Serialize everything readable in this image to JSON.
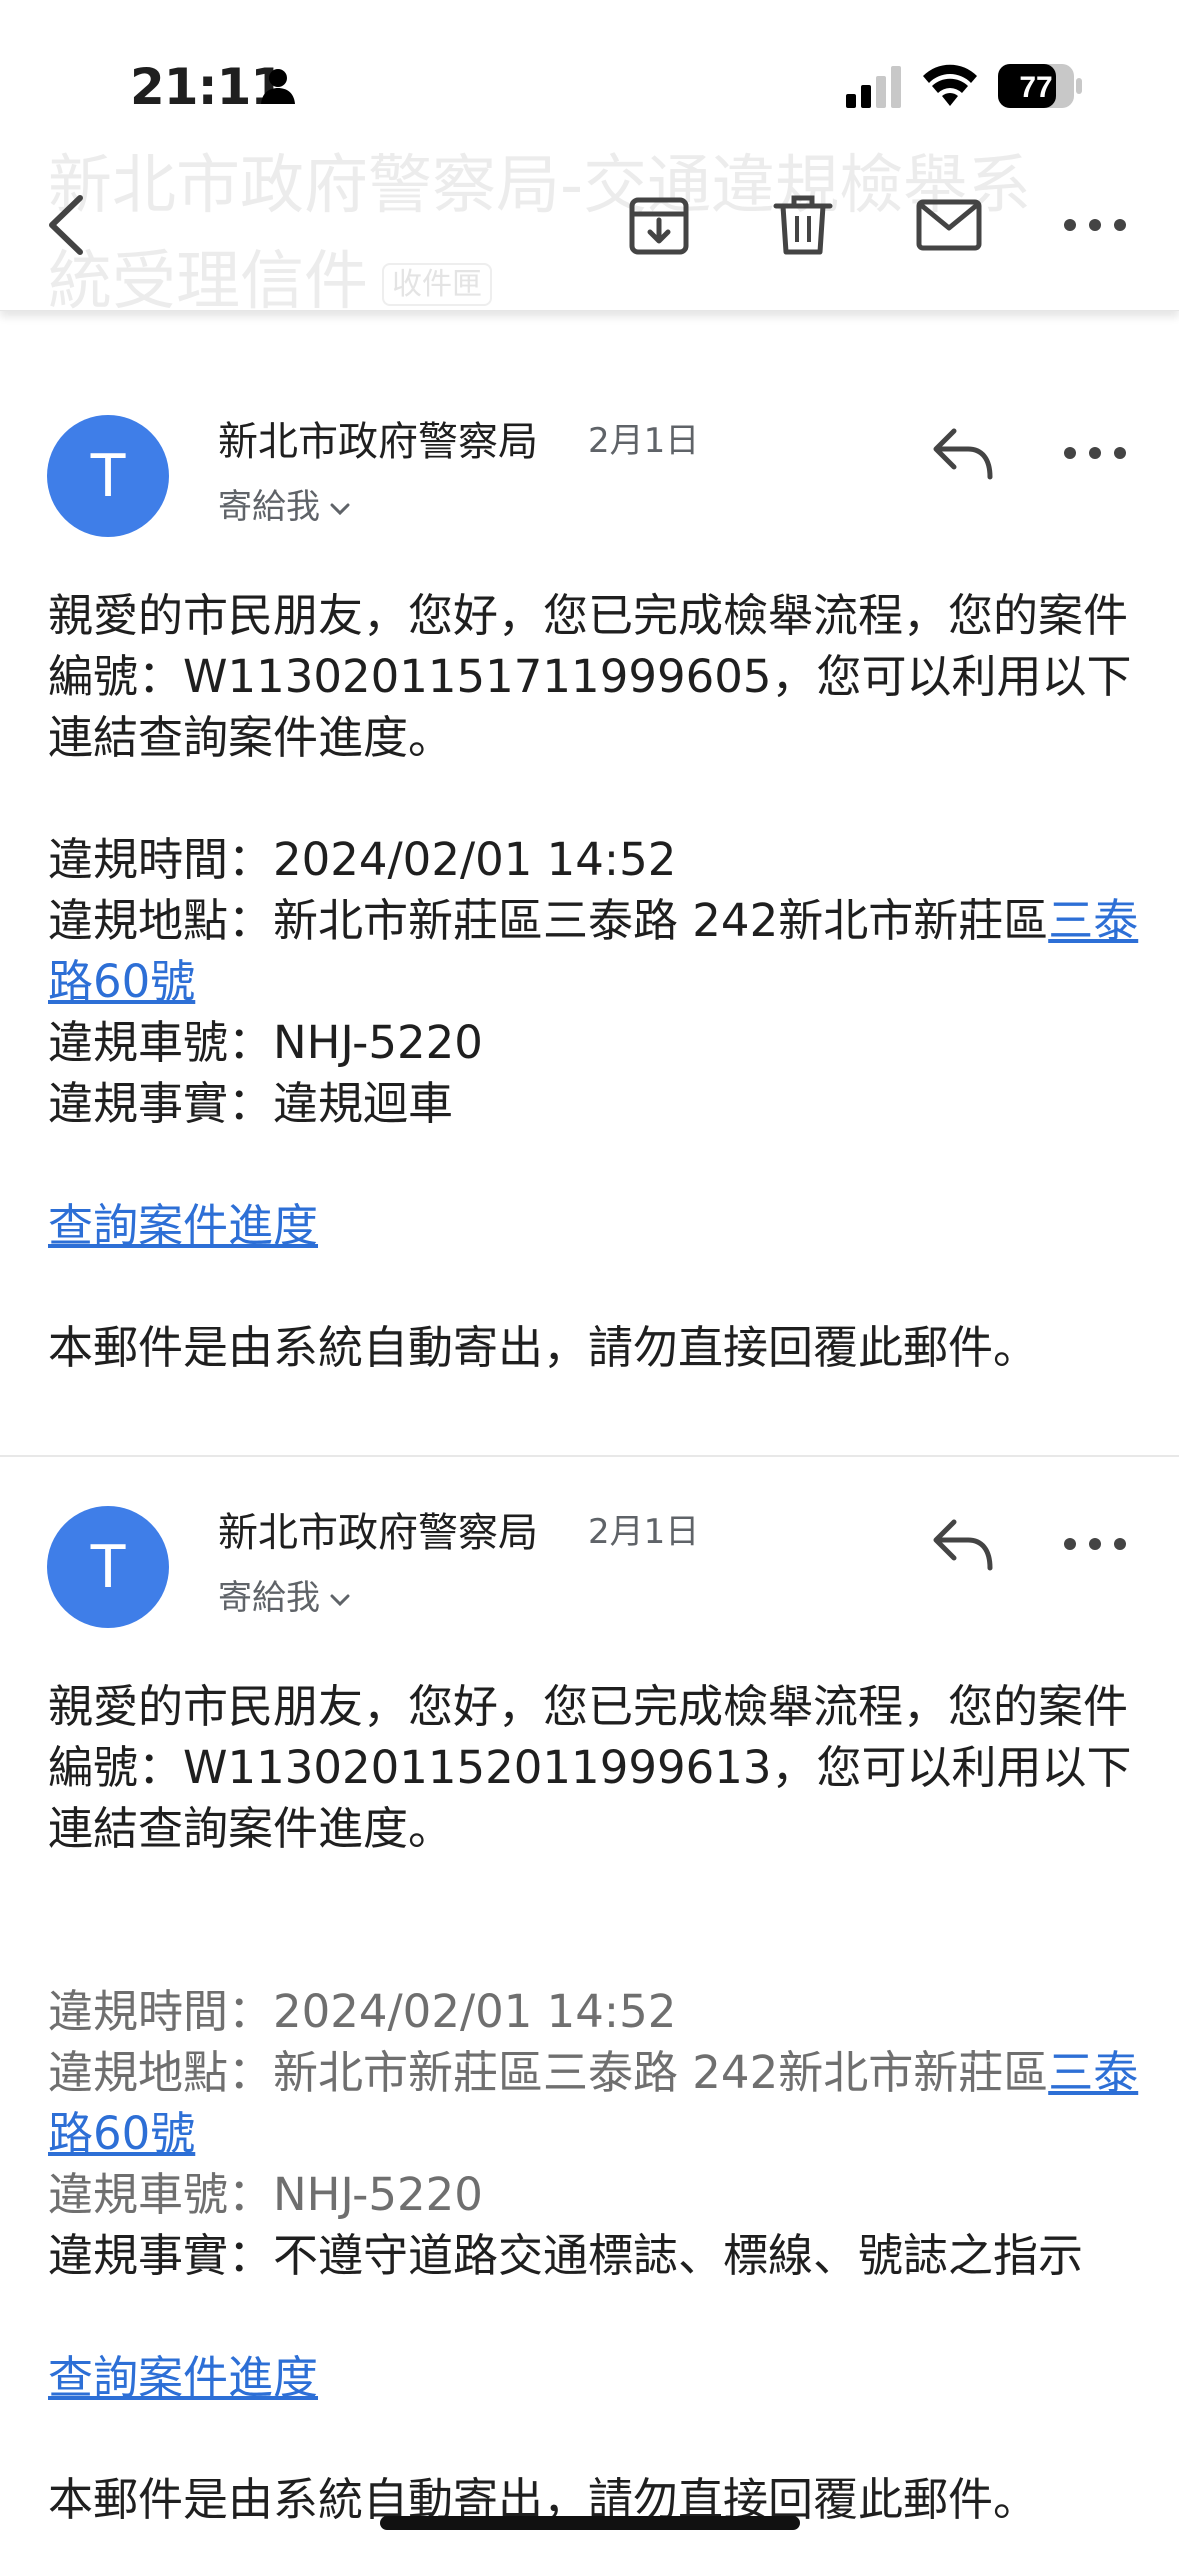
{
  "status_bar": {
    "time": "21:11",
    "battery": "77"
  },
  "header": {
    "title": "新北市政府警察局-交通違規檢舉系統受理信件",
    "label": "收件匣"
  },
  "messages": [
    {
      "avatar": "T",
      "sender": "新北市政府警察局",
      "date": "2月1日",
      "recipient": "寄給我",
      "intro": "親愛的市民朋友，您好，您已完成檢舉流程，您的案件編號：W1130201151711999605，您可以利用以下連結查詢案件進度。",
      "time_line": "違規時間：2024/02/01 14:52",
      "location_prefix": "違規地點：新北市新莊區三泰路 242新北市新莊區",
      "location_link": "三泰路60號",
      "plate_line": "違規車號：NHJ-5220",
      "fact_line": "違規事實：違規迴車",
      "progress_link": "查詢案件進度",
      "footer": "本郵件是由系統自動寄出，請勿直接回覆此郵件。"
    },
    {
      "avatar": "T",
      "sender": "新北市政府警察局",
      "date": "2月1日",
      "recipient": "寄給我",
      "intro": "親愛的市民朋友，您好，您已完成檢舉流程，您的案件編號：W1130201152011999613，您可以利用以下連結查詢案件進度。",
      "time_line": "違規時間：2024/02/01 14:52",
      "location_prefix": "違規地點：新北市新莊區三泰路 242新北市新莊區",
      "location_link": "三泰路60號",
      "plate_line": "違規車號：NHJ-5220",
      "fact_line": "違規事實：不遵守道路交通標誌、標線、號誌之指示",
      "progress_link": "查詢案件進度",
      "footer": "本郵件是由系統自動寄出，請勿直接回覆此郵件。"
    }
  ],
  "icons": {
    "back": "chevron-left-icon",
    "archive": "archive-icon",
    "delete": "trash-icon",
    "mark_unread": "mail-icon",
    "more": "more-horizontal-icon",
    "reply": "reply-icon"
  },
  "colors": {
    "avatar": "#3f7ee8",
    "link": "#2d6fd6"
  }
}
